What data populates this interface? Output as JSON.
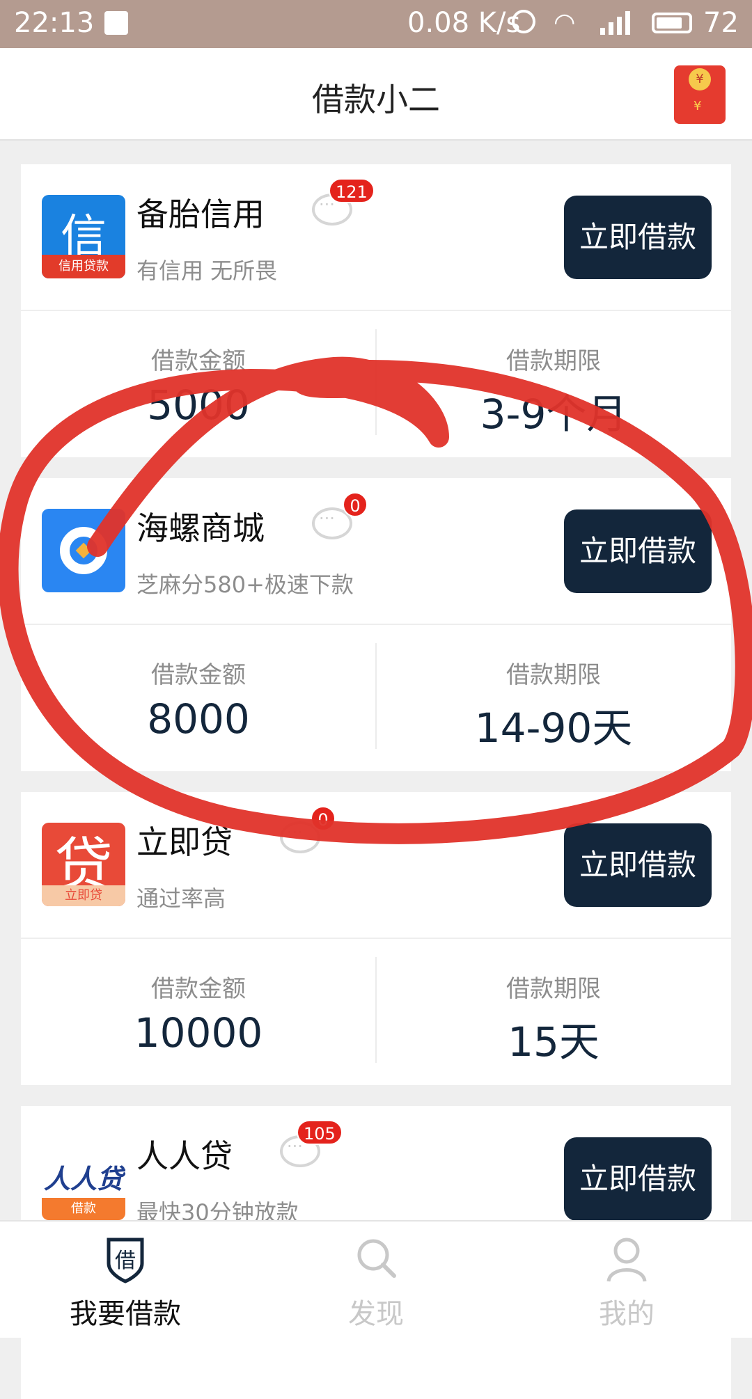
{
  "status_bar": {
    "time": "22:13",
    "network_speed": "0.08 K/s",
    "network_type": "4G",
    "battery": "72"
  },
  "header": {
    "title": "借款小二",
    "redpacket_icon": "red-envelope-icon"
  },
  "products": [
    {
      "name": "备胎信用",
      "slogan": "有信用 无所畏",
      "message_count": "121",
      "button": "立即借款",
      "amount_label": "借款金额",
      "amount": "5000",
      "term_label": "借款期限",
      "term": "3-9个月",
      "logo": {
        "char": "信",
        "strip": "信用贷款"
      }
    },
    {
      "name": "海螺商城",
      "slogan": "芝麻分580+极速下款",
      "message_count": "0",
      "button": "立即借款",
      "amount_label": "借款金额",
      "amount": "8000",
      "term_label": "借款期限",
      "term": "14-90天"
    },
    {
      "name": "立即贷",
      "slogan": "通过率高",
      "message_count": "0",
      "button": "立即借款",
      "amount_label": "借款金额",
      "amount": "10000",
      "term_label": "借款期限",
      "term": "15天",
      "logo": {
        "char": "贷",
        "strip": "立即贷"
      }
    },
    {
      "name": "人人贷",
      "slogan": "最快30分钟放款",
      "message_count": "105",
      "button": "立即借款",
      "logo": {
        "char": "人人贷",
        "strip": "借款"
      }
    }
  ],
  "tabs": [
    {
      "label": "我要借款",
      "icon": "shield-loan-icon",
      "active": true
    },
    {
      "label": "发现",
      "icon": "search-icon",
      "active": false
    },
    {
      "label": "我的",
      "icon": "user-icon",
      "active": false
    }
  ],
  "colors": {
    "status_bar": "#b49b90",
    "button": "#13263b",
    "badge": "#e4231c",
    "annotation": "#e0332a"
  }
}
